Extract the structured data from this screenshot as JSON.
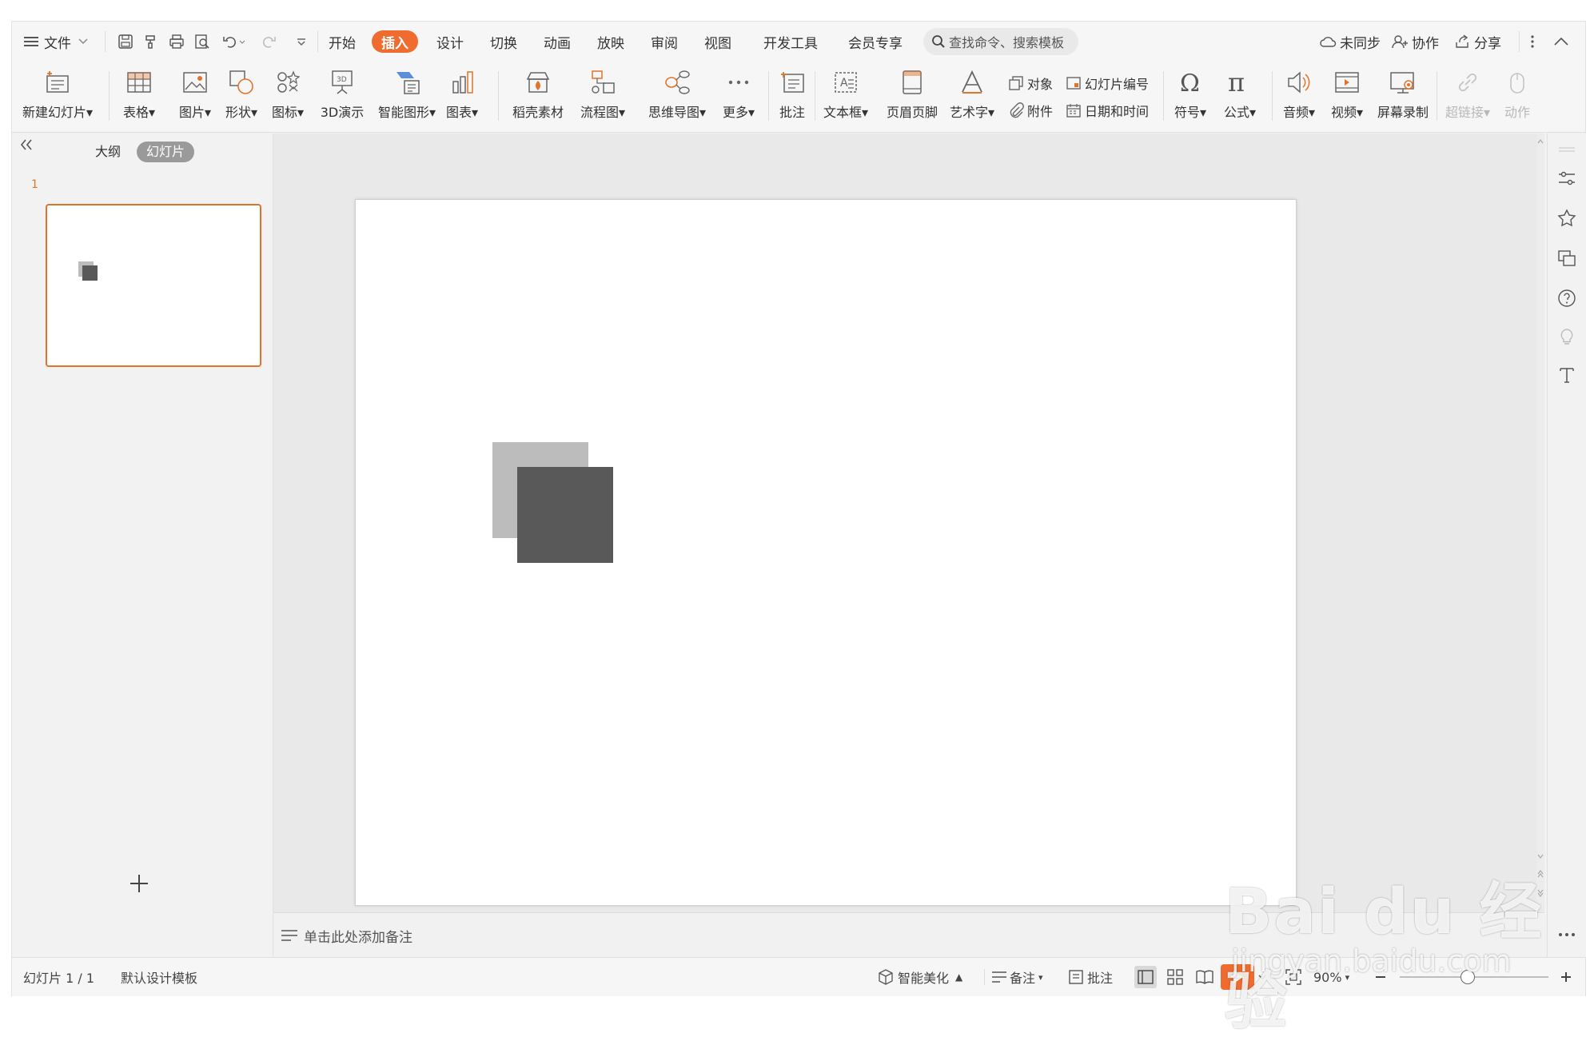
{
  "menu": {
    "file_label": "文件",
    "tabs": [
      "开始",
      "插入",
      "设计",
      "切换",
      "动画",
      "放映",
      "审阅",
      "视图",
      "开发工具",
      "会员专享"
    ],
    "active_tab": "插入",
    "search_placeholder": "查找命令、搜索模板",
    "right": {
      "sync": "未同步",
      "collab": "协作",
      "share": "分享"
    }
  },
  "ribbon": {
    "new_slide": "新建幻灯片",
    "table": "表格",
    "picture": "图片",
    "shape": "形状",
    "icon": "图标",
    "demo3d": "3D演示",
    "smartart": "智能图形",
    "chart": "图表",
    "docer": "稻壳素材",
    "flowchart": "流程图",
    "mindmap": "思维导图",
    "more": "更多",
    "comment": "批注",
    "textbox": "文本框",
    "header_footer": "页眉页脚",
    "wordart": "艺术字",
    "object": "对象",
    "slide_number": "幻灯片编号",
    "attachment": "附件",
    "datetime": "日期和时间",
    "symbol": "符号",
    "formula": "公式",
    "audio": "音频",
    "video": "视频",
    "screen_record": "屏幕录制",
    "hyperlink": "超链接",
    "action": "动作"
  },
  "left_panel": {
    "tab_outline": "大纲",
    "tab_slides": "幻灯片",
    "slide_number": "1"
  },
  "notes_placeholder": "单击此处添加备注",
  "status": {
    "slide_info": "幻灯片 1 / 1",
    "template": "默认设计模板",
    "beautify": "智能美化",
    "notes": "备注",
    "comments": "批注",
    "zoom": "90%"
  },
  "colors": {
    "accent": "#ef6b2f",
    "shape_back": "#bcbcbc",
    "shape_front": "#595959"
  },
  "watermark": {
    "brand": "Bai du 经验",
    "url": "jingyan.baidu.com"
  }
}
